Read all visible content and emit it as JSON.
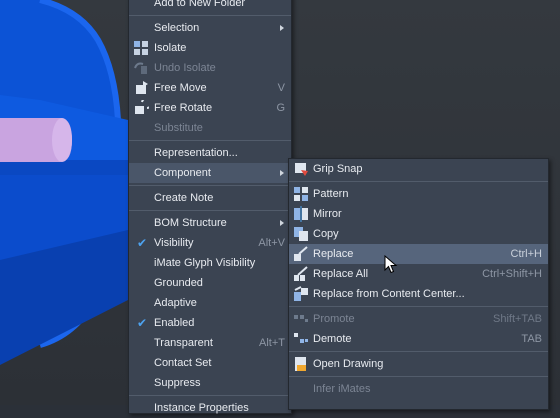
{
  "main_menu": {
    "items": [
      {
        "label": "Add to New Folder",
        "shortcut": ""
      },
      {
        "label": "Selection",
        "submenu": true
      },
      {
        "label": "Isolate",
        "icon": "isolate-icon"
      },
      {
        "label": "Undo Isolate",
        "icon": "undo-isolate-icon",
        "disabled": true
      },
      {
        "label": "Free Move",
        "shortcut": "V",
        "icon": "free-move-icon"
      },
      {
        "label": "Free Rotate",
        "shortcut": "G",
        "icon": "free-rotate-icon"
      },
      {
        "label": "Substitute",
        "disabled": true
      },
      {
        "label": "Representation..."
      },
      {
        "label": "Component",
        "submenu": true,
        "highlighted": true
      },
      {
        "label": "Create Note"
      },
      {
        "label": "BOM Structure",
        "submenu": true
      },
      {
        "label": "Visibility",
        "shortcut": "Alt+V",
        "checked": true
      },
      {
        "label": "iMate Glyph Visibility"
      },
      {
        "label": "Grounded"
      },
      {
        "label": "Adaptive"
      },
      {
        "label": "Enabled",
        "checked": true
      },
      {
        "label": "Transparent",
        "shortcut": "Alt+T"
      },
      {
        "label": "Contact Set"
      },
      {
        "label": "Suppress"
      },
      {
        "label": "Instance Properties"
      }
    ]
  },
  "component_submenu": {
    "items": [
      {
        "label": "Grip Snap",
        "icon": "grip-snap-icon"
      },
      {
        "label": "Pattern",
        "icon": "pattern-icon"
      },
      {
        "label": "Mirror",
        "icon": "mirror-icon"
      },
      {
        "label": "Copy",
        "icon": "copy-icon"
      },
      {
        "label": "Replace",
        "shortcut": "Ctrl+H",
        "icon": "replace-icon",
        "highlighted": true
      },
      {
        "label": "Replace All",
        "shortcut": "Ctrl+Shift+H",
        "icon": "replace-all-icon"
      },
      {
        "label": "Replace from Content Center...",
        "icon": "content-center-icon"
      },
      {
        "label": "Promote",
        "shortcut": "Shift+TAB",
        "icon": "promote-icon",
        "disabled": true
      },
      {
        "label": "Demote",
        "shortcut": "TAB",
        "icon": "demote-icon"
      },
      {
        "label": "Open Drawing",
        "icon": "open-drawing-icon"
      },
      {
        "label": "Infer iMates",
        "disabled": true
      }
    ]
  },
  "colors": {
    "menu_bg": "#3b4452",
    "highlight": "#56657c",
    "model_blue": "#0a4fd0",
    "model_pink": "#c7a2de",
    "check": "#4da3f0"
  }
}
